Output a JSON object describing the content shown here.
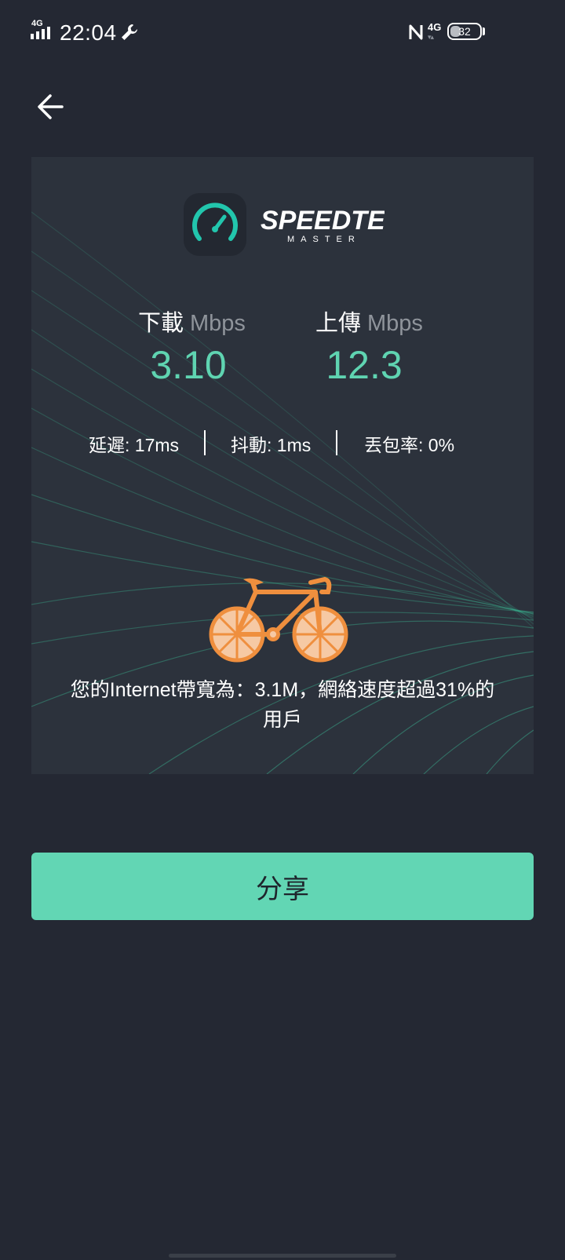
{
  "status_bar": {
    "network_left": "4G",
    "time": "22:04",
    "network_right": "4G",
    "battery": "32"
  },
  "logo": {
    "brand": "SPEEDTEST",
    "sub": "MASTER"
  },
  "download": {
    "label": "下載",
    "unit": "Mbps",
    "value": "3.10"
  },
  "upload": {
    "label": "上傳",
    "unit": "Mbps",
    "value": "12.3"
  },
  "stats": {
    "latency": "延遲: 17ms",
    "jitter": "抖動: 1ms",
    "packet_loss": "丟包率:  0%"
  },
  "caption": {
    "line1": "您的Internet帶寬為：3.1M，網絡速度超過31%的",
    "line2": "用戶"
  },
  "share_button": "分享",
  "colors": {
    "background": "#242833",
    "card": "#2c323c",
    "accent": "#5fd4b1",
    "bike": "#ef8f3e"
  },
  "icons": {
    "back": "arrow-left-icon",
    "speed": "speedometer-icon",
    "bike": "bicycle-icon"
  }
}
